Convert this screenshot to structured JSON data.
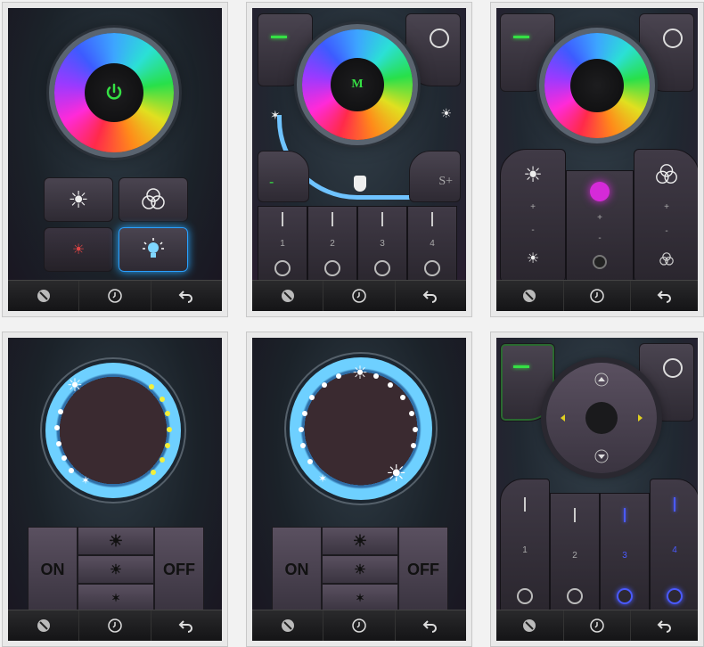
{
  "tabbar": {
    "items": [
      {
        "icon": "color-picker-icon"
      },
      {
        "icon": "clock-icon"
      },
      {
        "icon": "back-arrow-icon"
      }
    ]
  },
  "screen2": {
    "center_label": "M",
    "s_minus": "-",
    "s_plus": "S+",
    "zones": [
      "1",
      "2",
      "3",
      "4"
    ],
    "brightness_percent": 60
  },
  "screen3": {
    "plus": "+",
    "minus": "-"
  },
  "screen4": {
    "on_label": "ON",
    "off_label": "OFF"
  },
  "screen5": {
    "on_label": "ON",
    "off_label": "OFF"
  },
  "screen6": {
    "zones": [
      "1",
      "2",
      "3",
      "4"
    ],
    "active_zone": "3"
  },
  "colors": {
    "accent_green": "#35e044",
    "accent_blue": "#2aa0ff",
    "zone_active": "#4a5aff"
  }
}
